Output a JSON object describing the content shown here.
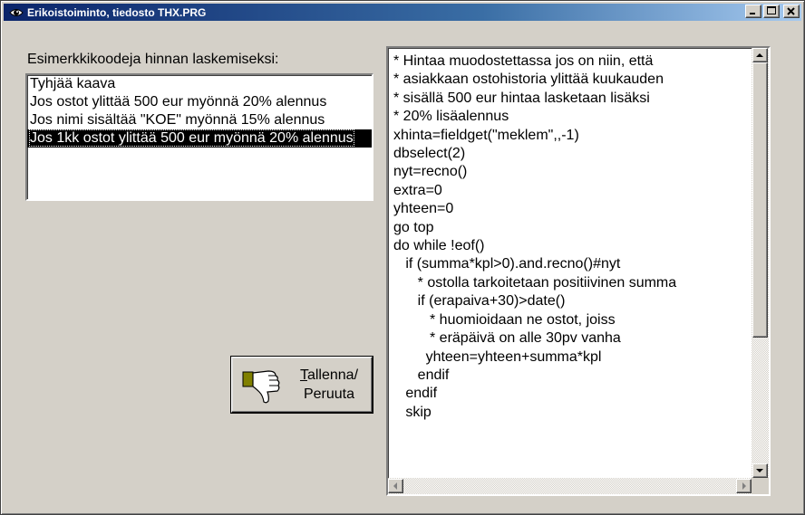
{
  "window": {
    "title": "Erikoistoiminto, tiedosto THX.PRG",
    "controls": [
      "minimize",
      "maximize",
      "close"
    ]
  },
  "examples": {
    "label": "Esimerkkikoodeja hinnan laskemiseksi:",
    "items": [
      {
        "label": "Tyhjää kaava",
        "selected": false
      },
      {
        "label": "Jos ostot ylittää 500 eur myönnä 20% alennus",
        "selected": false
      },
      {
        "label": "Jos nimi sisältää \"KOE\" myönnä 15% alennus",
        "selected": false
      },
      {
        "label": "Jos 1kk ostot ylittää 500 eur myönnä 20% alennus",
        "selected": true
      }
    ]
  },
  "save_button": {
    "label_line1": "Tallenna/",
    "label_line2": "Peruuta",
    "icon": "thumbs-down-icon"
  },
  "editor": {
    "lines": [
      "* Hintaa muodostettassa jos on niin, että",
      "* asiakkaan ostohistoria ylittää kuukauden",
      "* sisällä 500 eur hintaa lasketaan lisäksi",
      "* 20% lisäalennus",
      "xhinta=fieldget(\"meklem\",,-1)",
      "dbselect(2)",
      "nyt=recno()",
      "extra=0",
      "yhteen=0",
      "go top",
      "do while !eof()",
      "   if (summa*kpl>0).and.recno()#nyt",
      "      * ostolla tarkoitetaan positiivinen summa",
      "      if (erapaiva+30)>date()",
      "         * huomioidaan ne ostot, joiss",
      "         * eräpäivä on alle 30pv vanha",
      "        yhteen=yhteen+summa*kpl",
      "      endif",
      "   endif",
      "   skip"
    ]
  },
  "colors": {
    "titlebar_start": "#0a246a",
    "titlebar_end": "#a6caf0",
    "face": "#d4d0c8",
    "selection": "#000000"
  }
}
